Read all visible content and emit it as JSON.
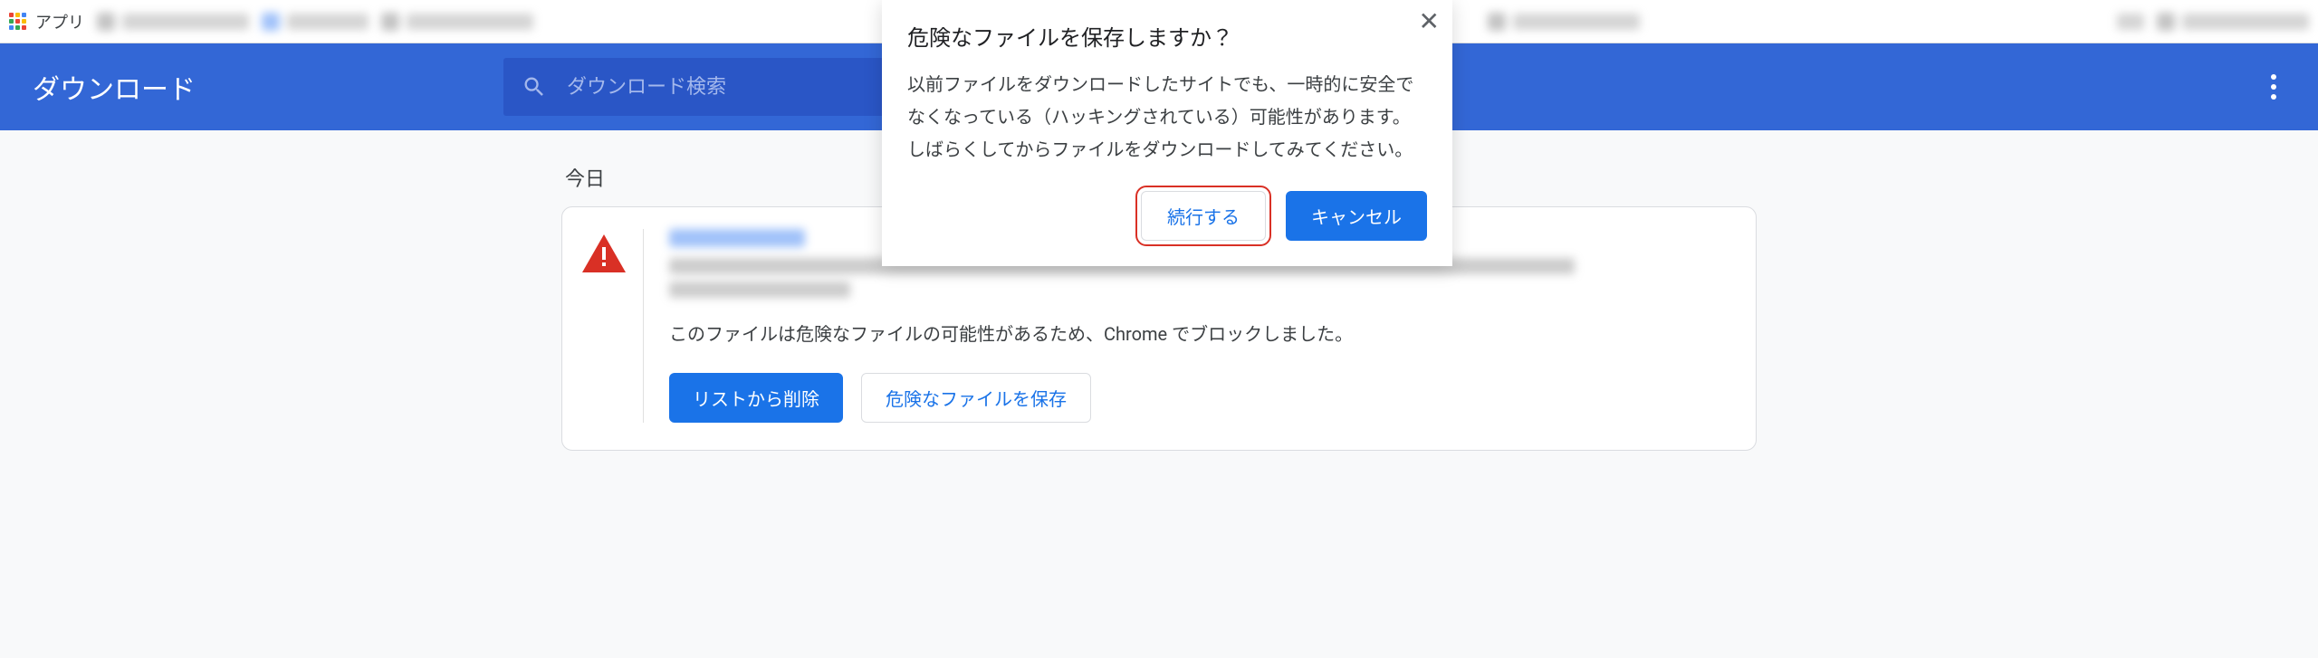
{
  "bookmarks": {
    "apps_label": "アプリ"
  },
  "header": {
    "title": "ダウンロード",
    "search_placeholder": "ダウンロード検索"
  },
  "section": {
    "today_label": "今日"
  },
  "download_item": {
    "warning_text": "このファイルは危険なファイルの可能性があるため、Chrome でブロックしました。",
    "remove_button": "リストから削除",
    "keep_button": "危険なファイルを保存"
  },
  "dialog": {
    "title": "危険なファイルを保存しますか？",
    "body": "以前ファイルをダウンロードしたサイトでも、一時的に安全でなくなっている（ハッキングされている）可能性があります。しばらくしてからファイルをダウンロードしてみてください。",
    "continue_button": "続行する",
    "cancel_button": "キャンセル"
  }
}
